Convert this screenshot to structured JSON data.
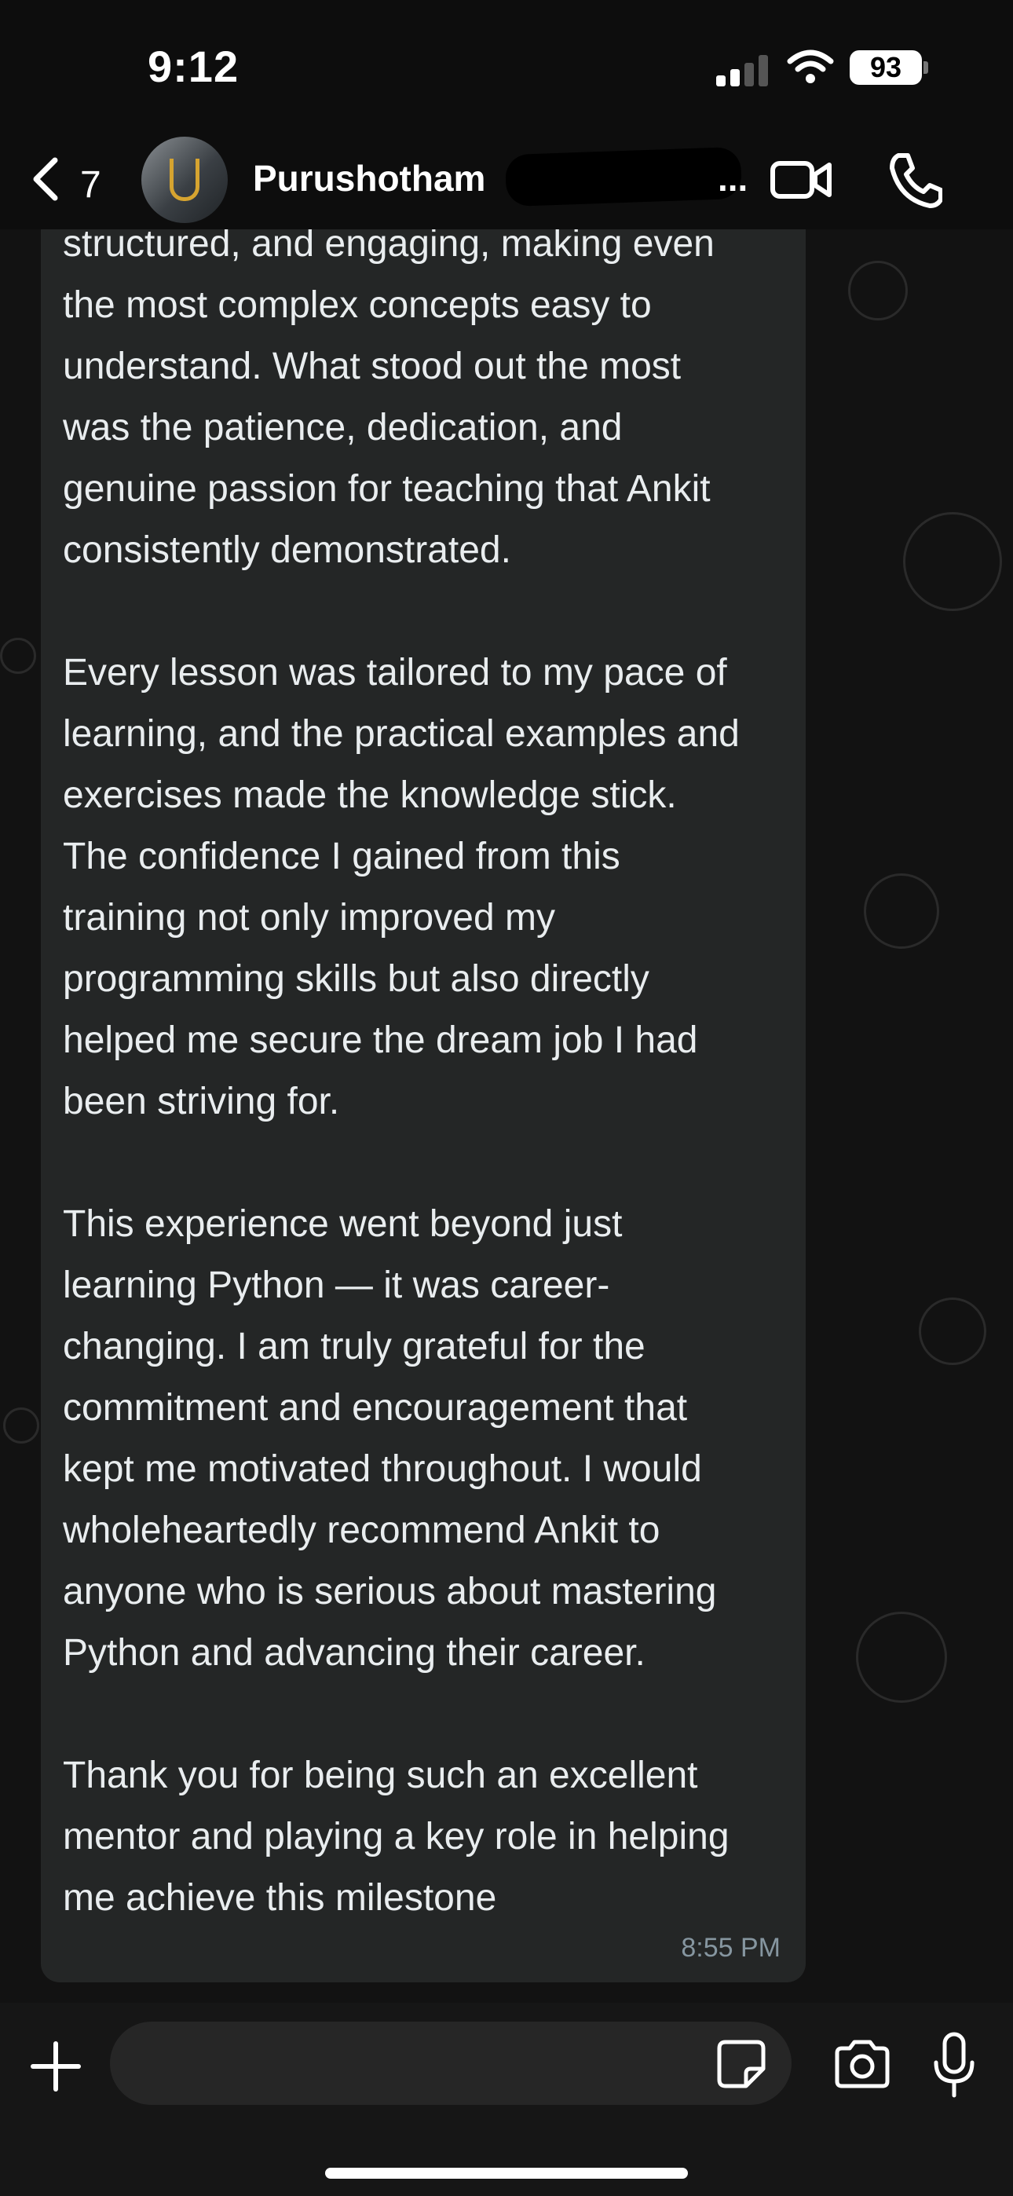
{
  "status_bar": {
    "time": "9:12",
    "battery": "93"
  },
  "header": {
    "back_count": "7",
    "contact_name": "Purushotham",
    "name_ellipsis": "..."
  },
  "message": {
    "text": "structured, and engaging, making even\nthe most complex concepts easy to\nunderstand. What stood out the most\nwas the patience, dedication, and\ngenuine passion for teaching that Ankit\nconsistently demonstrated.\n\nEvery lesson was tailored to my pace of\nlearning, and the practical examples and\nexercises made the knowledge stick.\nThe confidence I gained from this\ntraining not only improved my\nprogramming skills but also directly\nhelped me secure the dream job I had\nbeen striving for.\n\nThis experience went beyond just\nlearning Python — it was career-\nchanging. I am truly grateful for the\ncommitment and encouragement that\nkept me motivated throughout. I would\nwholeheartedly recommend Ankit to\nanyone who is serious about mastering\nPython and advancing their career.\n\nThank you for being such an excellent\nmentor and playing a key role in helping\nme achieve this milestone",
    "time": "8:55 PM"
  },
  "composer": {
    "input_value": "",
    "input_placeholder": ""
  },
  "icons": {
    "back": "chevron-left-icon",
    "video": "video-camera-icon",
    "call": "phone-icon",
    "plus": "plus-icon",
    "sticker": "sticker-icon",
    "camera": "camera-icon",
    "mic": "microphone-icon"
  },
  "colors": {
    "background": "#121212",
    "bubble": "#242626",
    "text": "#e9edef",
    "timestamp": "#8696a0"
  }
}
